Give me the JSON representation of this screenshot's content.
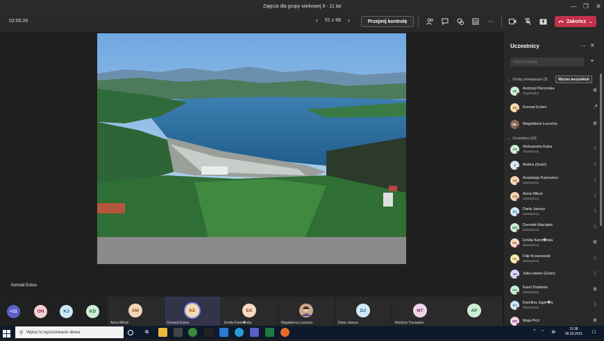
{
  "window": {
    "title": "Zajęcia dla grupy wiekowej 9 - 11 lat"
  },
  "toolbar": {
    "timer": "02:00:26",
    "page_counter": "51 z 88",
    "take_control_label": "Przejmij kontrolę",
    "end_label": "Zakończ"
  },
  "stage": {
    "presenter_name": "Konrad Eckes"
  },
  "strip": {
    "bubbles": [
      {
        "initials": "+11",
        "bg": "#5b5fc7",
        "fg": "#ffffff"
      },
      {
        "initials": "ON",
        "bg": "#f5cfd6",
        "fg": "#8a2a3a"
      },
      {
        "initials": "KJ",
        "bg": "#cfe8f5",
        "fg": "#1f5f85"
      },
      {
        "initials": "KD",
        "bg": "#cdeed6",
        "fg": "#2a6e3f"
      }
    ],
    "tiles": [
      {
        "initials": "AM",
        "name": "Anna Mikoś",
        "bg": "#f3d5b5",
        "fg": "#8a5a2a"
      },
      {
        "initials": "KE",
        "name": "Konrad Eckes",
        "bg": "#f5dcb0",
        "fg": "#8a5a1a"
      },
      {
        "initials": "EK",
        "name": "Emilia Kami�ska",
        "bg": "#f8d9c2",
        "fg": "#8a4a2a"
      },
      {
        "initials": "",
        "name": "Magdalena Lezucha",
        "bg": "#8a6a5a",
        "fg": "#ffffff"
      },
      {
        "initials": "DJ",
        "name": "Daria Janusz",
        "bg": "#cfe8f5",
        "fg": "#1f5f85"
      },
      {
        "initials": "MT",
        "name": "Martyna Tuczapiec",
        "bg": "#f0d5e8",
        "fg": "#7a2a6a"
      },
      {
        "initials": "AP",
        "name": "",
        "bg": "#cdeed6",
        "fg": "#2a6e3f"
      }
    ]
  },
  "panel": {
    "title": "Uczestnicy",
    "search_placeholder": "Wpisz nazwę",
    "presenters_header": "Osoby prowadzące (3)",
    "mute_all_label": "Wycisz wszystkich",
    "attendees_header": "Uczestnicy (18)",
    "presenters": [
      {
        "initials": "AP",
        "name": "Andrzej Pieczonka",
        "role": "Organizator",
        "bg": "#cdeed6",
        "fg": "#2a6e3f",
        "status": "#c4314b",
        "mic": "muted"
      },
      {
        "initials": "KE",
        "name": "Konrad Eckes",
        "role": "",
        "bg": "#f5dcb0",
        "fg": "#8a5a1a",
        "status": "#c4314b",
        "mic": "on"
      },
      {
        "initials": "ML",
        "name": "Magdalena Lezucha",
        "role": "",
        "bg": "#8a6a5a",
        "fg": "#ffffff",
        "status": "#c4314b",
        "mic": "muted"
      }
    ],
    "attendees": [
      {
        "initials": "AR",
        "name": "Aleksandra Raba",
        "role": "Zewnętrzny",
        "bg": "#cdeed6",
        "fg": "#2a6e3f",
        "status": "#c4314b",
        "mic": "off"
      },
      {
        "initials": "A",
        "name": "Ambra (Gość)",
        "role": "",
        "bg": "#d9e6f0",
        "fg": "#2a4a6a",
        "status": "#c4314b",
        "mic": "off"
      },
      {
        "initials": "AK",
        "name": "Anastazja Koprowicz",
        "role": "Zewnętrzny",
        "bg": "#f3d5b5",
        "fg": "#8a5a2a",
        "status": "#c4314b",
        "mic": "off"
      },
      {
        "initials": "AM",
        "name": "Anna Mikoś",
        "role": "Zewnętrzny",
        "bg": "#f3d5b5",
        "fg": "#8a5a2a",
        "status": "#c4314b",
        "mic": "off"
      },
      {
        "initials": "DJ",
        "name": "Daria Janusz",
        "role": "Zewnętrzny",
        "bg": "#cfe8f5",
        "fg": "#1f5f85",
        "status": "#c4314b",
        "mic": "off"
      },
      {
        "initials": "DM",
        "name": "Dominik Maciałek",
        "role": "Zewnętrzny",
        "bg": "#cdeed6",
        "fg": "#2a6e3f",
        "status": "#c4314b",
        "mic": "off"
      },
      {
        "initials": "EK",
        "name": "Emilia Kami�ska",
        "role": "Zewnętrzny",
        "bg": "#f8d9c2",
        "fg": "#8a4a2a",
        "status": "#c4314b",
        "mic": "muted"
      },
      {
        "initials": "FK",
        "name": "Filip Krzanowski",
        "role": "Zewnętrzny",
        "bg": "#f5e9b5",
        "fg": "#7a6a1a",
        "status": "#c4314b",
        "mic": "off"
      },
      {
        "initials": "JH",
        "name": "Julia Hawro (Gość)",
        "role": "",
        "bg": "#dcd5f5",
        "fg": "#4a3a8a",
        "status": "#c4314b",
        "mic": "off"
      },
      {
        "initials": "KD",
        "name": "Karol Dublanin",
        "role": "Zewnętrzny",
        "bg": "#cdeed6",
        "fg": "#2a6e3f",
        "status": "#c4314b",
        "mic": "muted"
      },
      {
        "initials": "KJ",
        "name": "Karolina Jagie�a",
        "role": "Zewnętrzny",
        "bg": "#cfe8f5",
        "fg": "#1f5f85",
        "status": "#c4314b",
        "mic": "off"
      },
      {
        "initials": "MP",
        "name": "Maja Pich",
        "role": "",
        "bg": "#f0d5e8",
        "fg": "#7a2a6a",
        "status": "#c4314b",
        "mic": "muted"
      }
    ]
  },
  "taskbar": {
    "search_placeholder": "Wpisz tu wyszukiwane słowa",
    "time": "11:38",
    "date": "06.03.2021"
  }
}
